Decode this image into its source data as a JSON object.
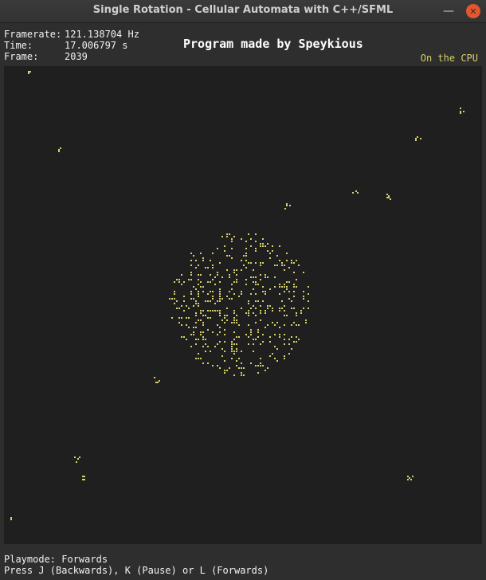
{
  "window": {
    "title": "Single Rotation - Cellular Automata with C++/SFML",
    "minimize_symbol": "—",
    "close_symbol": "✕"
  },
  "stats": {
    "framerate_label": "Framerate:",
    "framerate_value": "121.138704 Hz",
    "time_label": "Time:",
    "time_value": "17.006797 s",
    "frame_label": "Frame:",
    "frame_value": "2039"
  },
  "credit": "Program made by Speykious",
  "mode_label": "On the CPU",
  "footer": {
    "playmode": "Playmode: Forwards",
    "controls": "Press J (Backwards), K (Pause) or L (Forwards)"
  },
  "colors": {
    "cell": "#d7d06a",
    "canvas_bg": "#1f1f1f",
    "mode_text": "#d6cf6a",
    "close_button": "#e3562e"
  }
}
